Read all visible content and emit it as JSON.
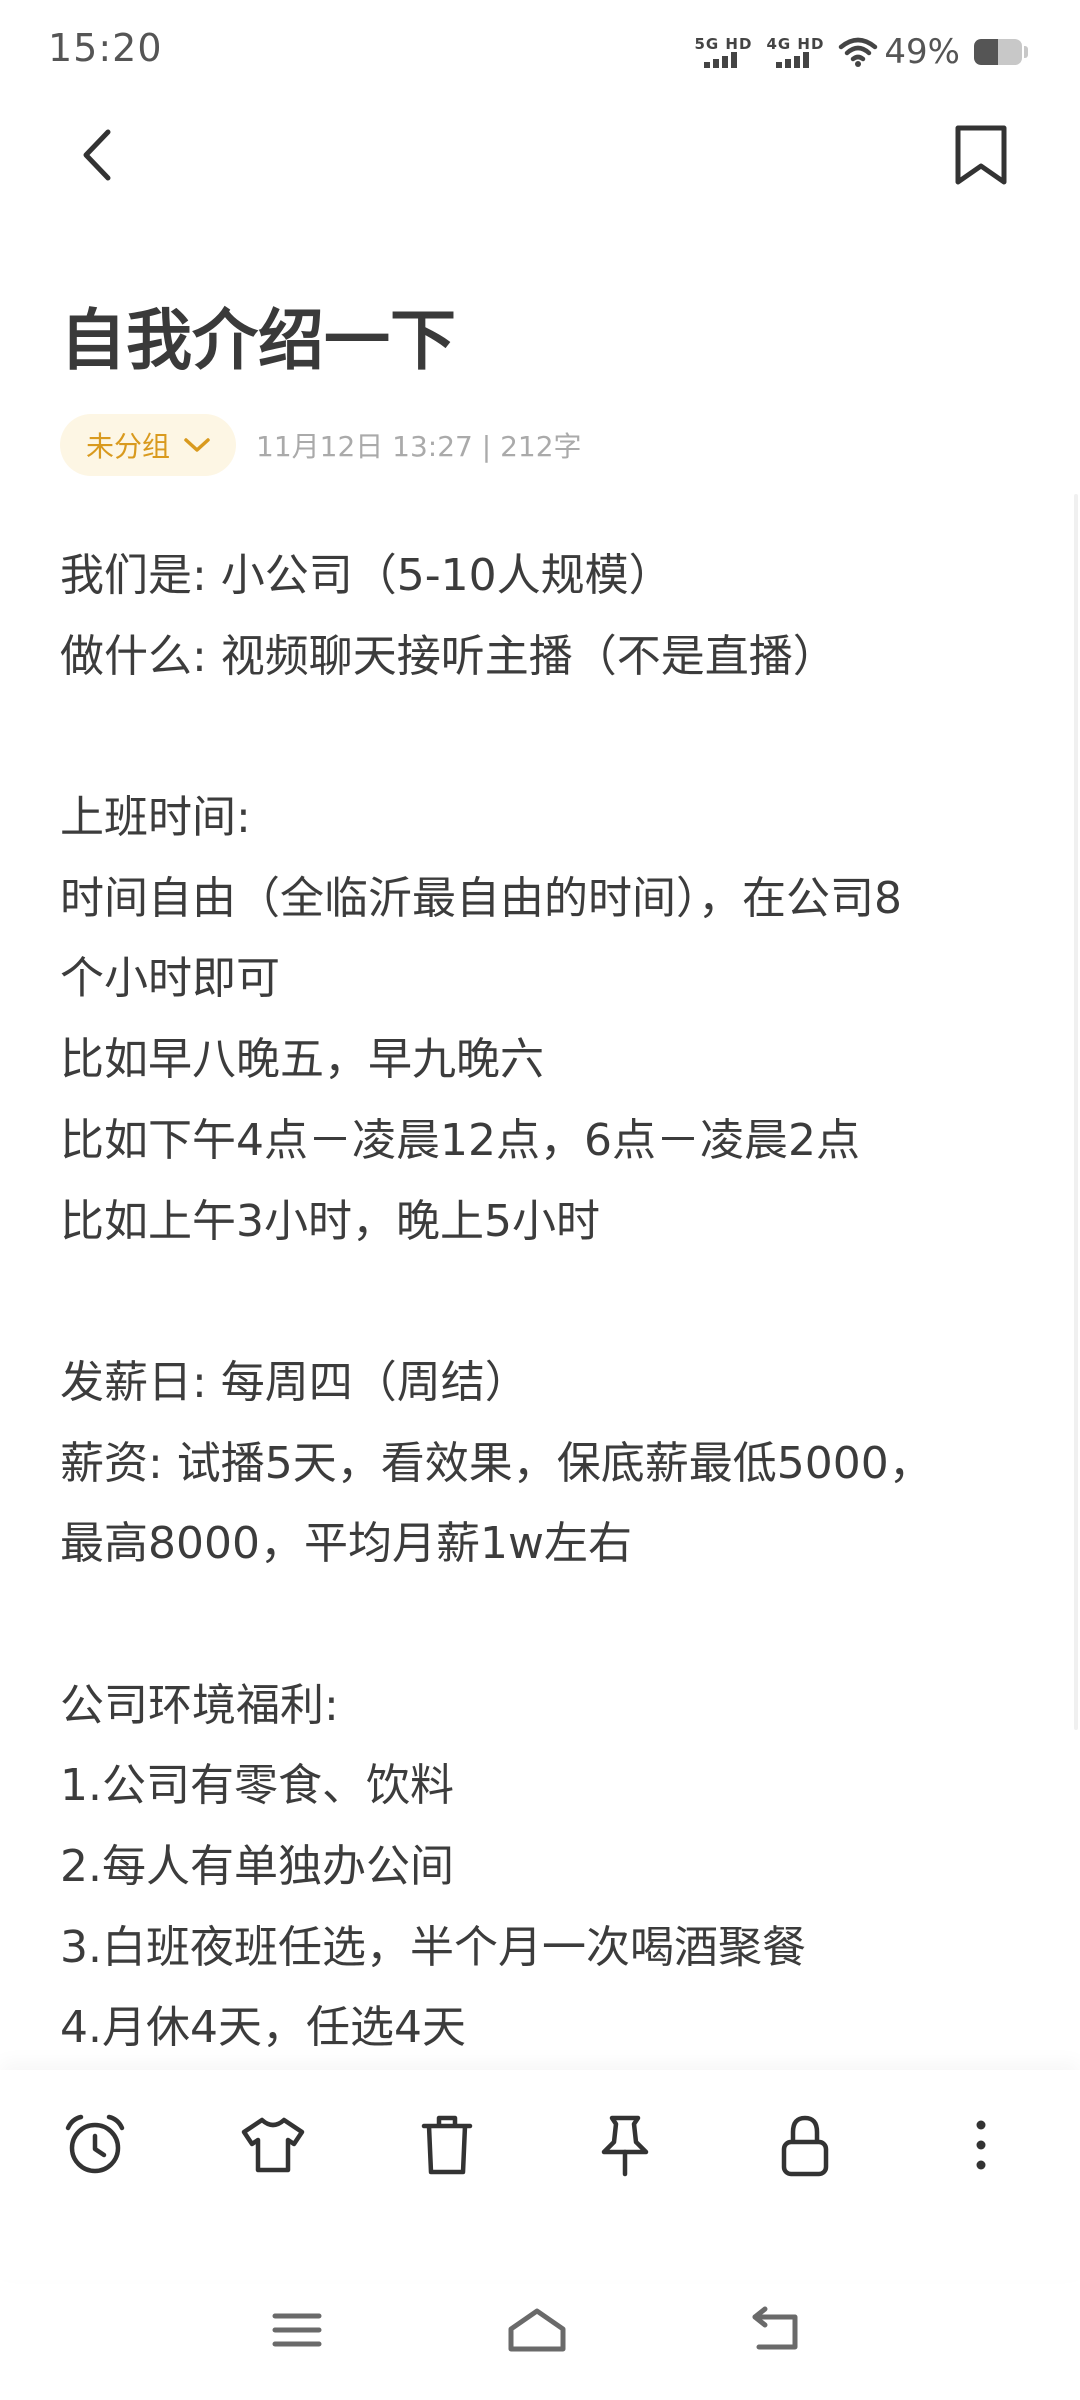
{
  "status_bar": {
    "time": "15:20",
    "network_1": "5G HD",
    "network_2": "4G HD",
    "battery_text": "49%",
    "battery_level": 0.49
  },
  "top_bar": {
    "back_icon": "chevron-left-icon",
    "bookmark_icon": "bookmark-icon"
  },
  "note": {
    "title": "自我介绍一下",
    "group_label": "未分组",
    "meta": "11月12日 13:27  |  212字",
    "lines": [
      "我们是: 小公司（5-10人规模）",
      "做什么: 视频聊天接听主播（不是直播）",
      "",
      "上班时间:",
      "时间自由（全临沂最自由的时间），在公司8",
      "个小时即可",
      "比如早八晚五，早九晚六",
      "比如下午4点－凌晨12点，6点－凌晨2点",
      "比如上午3小时，晚上5小时",
      "",
      "发薪日: 每周四（周结）",
      "薪资: 试播5天，看效果，保底薪最低5000，",
      "最高8000，平均月薪1w左右",
      "",
      "公司环境福利:",
      "1.公司有零食、饮料",
      "2.每人有单独办公间",
      "3.白班夜班任选，半个月一次喝酒聚餐",
      "4.月休4天，任选4天"
    ]
  },
  "toolbar": {
    "icons": [
      "alarm-clock-icon",
      "shirt-icon",
      "trash-icon",
      "pin-icon",
      "lock-icon",
      "more-vertical-icon"
    ]
  },
  "nav_bar": {
    "icons": [
      "menu-icon",
      "home-icon",
      "back-icon"
    ]
  },
  "colors": {
    "accent": "#d99a1e",
    "chip_background": "#fdf6e4",
    "text": "#3c3c3c",
    "meta_text": "#aaaaaa"
  }
}
